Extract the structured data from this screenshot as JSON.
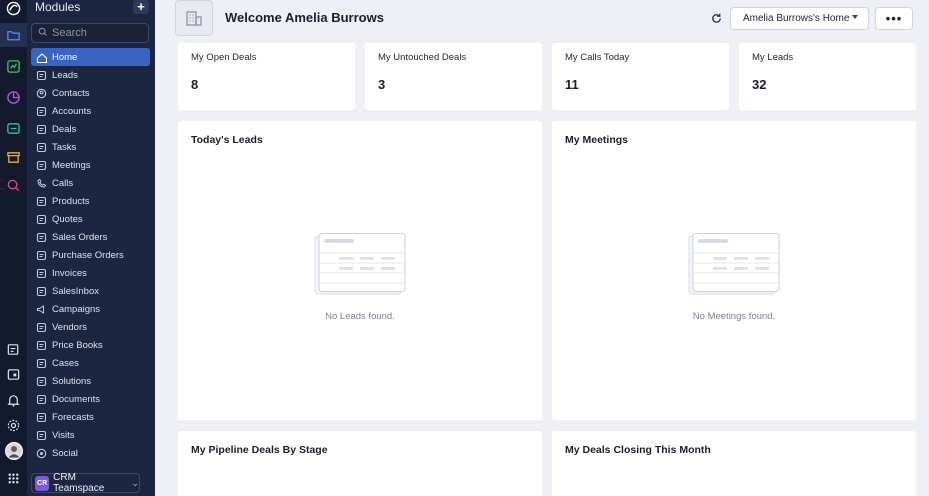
{
  "sidebar": {
    "title": "Modules",
    "add_label": "+",
    "search_placeholder": "Search",
    "items": [
      {
        "label": "Home",
        "icon": "home-icon",
        "active": true
      },
      {
        "label": "Leads",
        "icon": "leads-icon"
      },
      {
        "label": "Contacts",
        "icon": "contacts-icon"
      },
      {
        "label": "Accounts",
        "icon": "accounts-icon"
      },
      {
        "label": "Deals",
        "icon": "deals-icon"
      },
      {
        "label": "Tasks",
        "icon": "tasks-icon"
      },
      {
        "label": "Meetings",
        "icon": "meetings-icon"
      },
      {
        "label": "Calls",
        "icon": "calls-icon"
      },
      {
        "label": "Products",
        "icon": "products-icon"
      },
      {
        "label": "Quotes",
        "icon": "quotes-icon"
      },
      {
        "label": "Sales Orders",
        "icon": "sales-orders-icon"
      },
      {
        "label": "Purchase Orders",
        "icon": "purchase-orders-icon"
      },
      {
        "label": "Invoices",
        "icon": "invoices-icon"
      },
      {
        "label": "SalesInbox",
        "icon": "salesinbox-icon"
      },
      {
        "label": "Campaigns",
        "icon": "campaigns-icon"
      },
      {
        "label": "Vendors",
        "icon": "vendors-icon"
      },
      {
        "label": "Price Books",
        "icon": "price-books-icon"
      },
      {
        "label": "Cases",
        "icon": "cases-icon"
      },
      {
        "label": "Solutions",
        "icon": "solutions-icon"
      },
      {
        "label": "Documents",
        "icon": "documents-icon"
      },
      {
        "label": "Forecasts",
        "icon": "forecasts-icon"
      },
      {
        "label": "Visits",
        "icon": "visits-icon"
      },
      {
        "label": "Social",
        "icon": "social-icon"
      }
    ],
    "teamspace": {
      "badge": "CR",
      "label": "CRM Teamspace"
    }
  },
  "header": {
    "welcome": "Welcome Amelia Burrows",
    "home_select": "Amelia Burrows's Home",
    "more_label": "•••"
  },
  "kpis": [
    {
      "label": "My Open Deals",
      "value": "8"
    },
    {
      "label": "My Untouched Deals",
      "value": "3"
    },
    {
      "label": "My Calls Today",
      "value": "11"
    },
    {
      "label": "My Leads",
      "value": "32"
    }
  ],
  "panels": {
    "todays_leads": {
      "title": "Today's Leads",
      "empty": "No Leads found."
    },
    "my_meetings": {
      "title": "My Meetings",
      "empty": "No Meetings found."
    },
    "pipeline": {
      "title": "My Pipeline Deals By Stage"
    },
    "closing": {
      "title": "My Deals Closing This Month"
    }
  },
  "colors": {
    "rail_bg": "#141a2d",
    "sidebar_bg": "#1d2640",
    "active_item": "#3a64c4",
    "main_bg": "#eef0f6",
    "card_bg": "#ffffff"
  }
}
